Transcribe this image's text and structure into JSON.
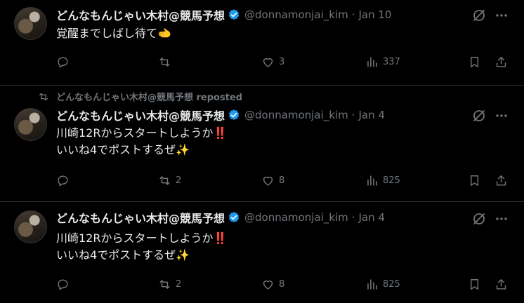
{
  "posts": [
    {
      "author_name": "どんなもんじゃい木村@競馬予想",
      "handle": "@donnamonjai_kim",
      "separator": "·",
      "date": "Jan 10",
      "text": "覚醒までしばし待て🫲",
      "reposted_by": null,
      "stats": {
        "replies": "",
        "reposts": "",
        "likes": "3",
        "views": "337"
      }
    },
    {
      "author_name": "どんなもんじゃい木村@競馬予想",
      "handle": "@donnamonjai_kim",
      "separator": "·",
      "date": "Jan 4",
      "text": "川崎12Rからスタートしようか‼️\nいいね4でポストするぜ✨",
      "reposted_by": "どんなもんじゃい木村@競馬予想 reposted",
      "stats": {
        "replies": "",
        "reposts": "2",
        "likes": "8",
        "views": "825"
      }
    },
    {
      "author_name": "どんなもんじゃい木村@競馬予想",
      "handle": "@donnamonjai_kim",
      "separator": "·",
      "date": "Jan 4",
      "text": "川崎12Rからスタートしようか‼️\nいいね4でポストするぜ✨",
      "reposted_by": null,
      "stats": {
        "replies": "",
        "reposts": "2",
        "likes": "8",
        "views": "825"
      }
    }
  ],
  "icons": {
    "verified": "verified-badge-icon",
    "grok": "grok-icon",
    "more": "more-icon",
    "reply": "reply-icon",
    "repost": "repost-icon",
    "like": "like-icon",
    "views": "views-icon",
    "bookmark": "bookmark-icon",
    "share": "share-icon"
  },
  "colors": {
    "background": "#000000",
    "text": "#e7e9ea",
    "muted": "#71767b",
    "verified": "#1d9bf0",
    "divider": "#2f3336"
  }
}
